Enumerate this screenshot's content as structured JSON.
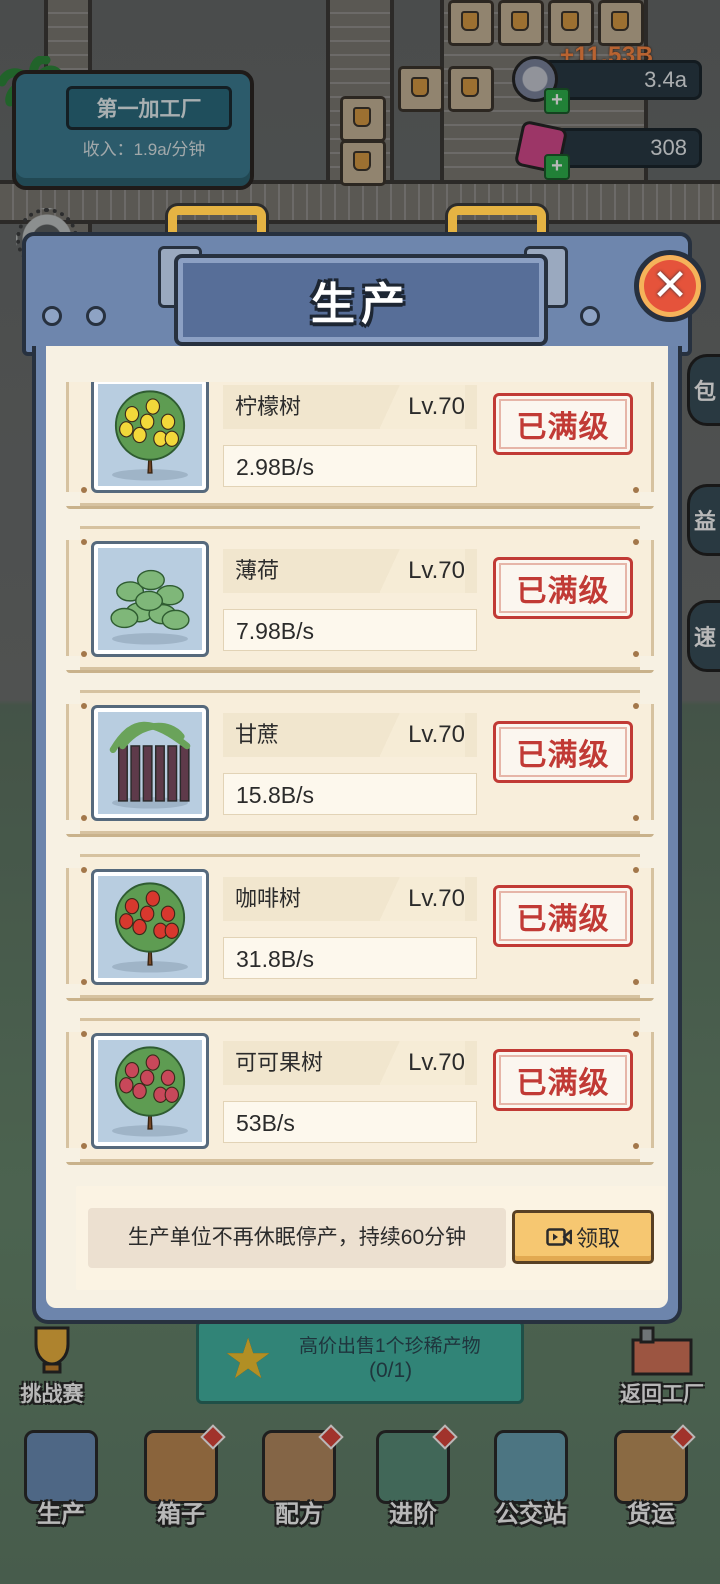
{
  "hud": {
    "factory_name": "第一加工厂",
    "factory_income": "收入：1.9a/分钟",
    "income_popup": "+11.53B",
    "coins": "3.4a",
    "gems": "308",
    "side_tabs": [
      "包",
      "益",
      "速"
    ]
  },
  "modal": {
    "title": "生产",
    "close_symbol": "✕",
    "items": [
      {
        "name": "柠檬树",
        "level": "Lv.70",
        "rate": "2.98B/s",
        "status": "已满级",
        "fruit_color": "#f2d83a"
      },
      {
        "name": "薄荷",
        "level": "Lv.70",
        "rate": "7.98B/s",
        "status": "已满级",
        "fruit_color": "#6fa86a"
      },
      {
        "name": "甘蔗",
        "level": "Lv.70",
        "rate": "15.8B/s",
        "status": "已满级",
        "fruit_color": "#5e3a4a"
      },
      {
        "name": "咖啡树",
        "level": "Lv.70",
        "rate": "31.8B/s",
        "status": "已满级",
        "fruit_color": "#d8382e"
      },
      {
        "name": "可可果树",
        "level": "Lv.70",
        "rate": "53B/s",
        "status": "已满级",
        "fruit_color": "#c8485a"
      }
    ],
    "bonus_text": "生产单位不再休眠停产，持续60分钟",
    "claim_label": "领取"
  },
  "quest": {
    "text": "高价出售1个珍稀产物",
    "progress": "(0/1)"
  },
  "corner_buttons": {
    "left": "挑战赛",
    "right": "返回工厂"
  },
  "bottom_nav": [
    {
      "label": "生产",
      "color": "#6c8fb9",
      "badge": false
    },
    {
      "label": "箱子",
      "color": "#c08b54",
      "badge": true
    },
    {
      "label": "配方",
      "color": "#b78c62",
      "badge": true
    },
    {
      "label": "进阶",
      "color": "#5a8f7a",
      "badge": true
    },
    {
      "label": "公交站",
      "color": "#6aa3b4",
      "badge": false
    },
    {
      "label": "货运",
      "color": "#c0935e",
      "badge": true
    }
  ],
  "colors": {
    "accent_red": "#c13a35",
    "panel_blue": "#6d85ac",
    "claim_yellow": "#f6c771"
  }
}
